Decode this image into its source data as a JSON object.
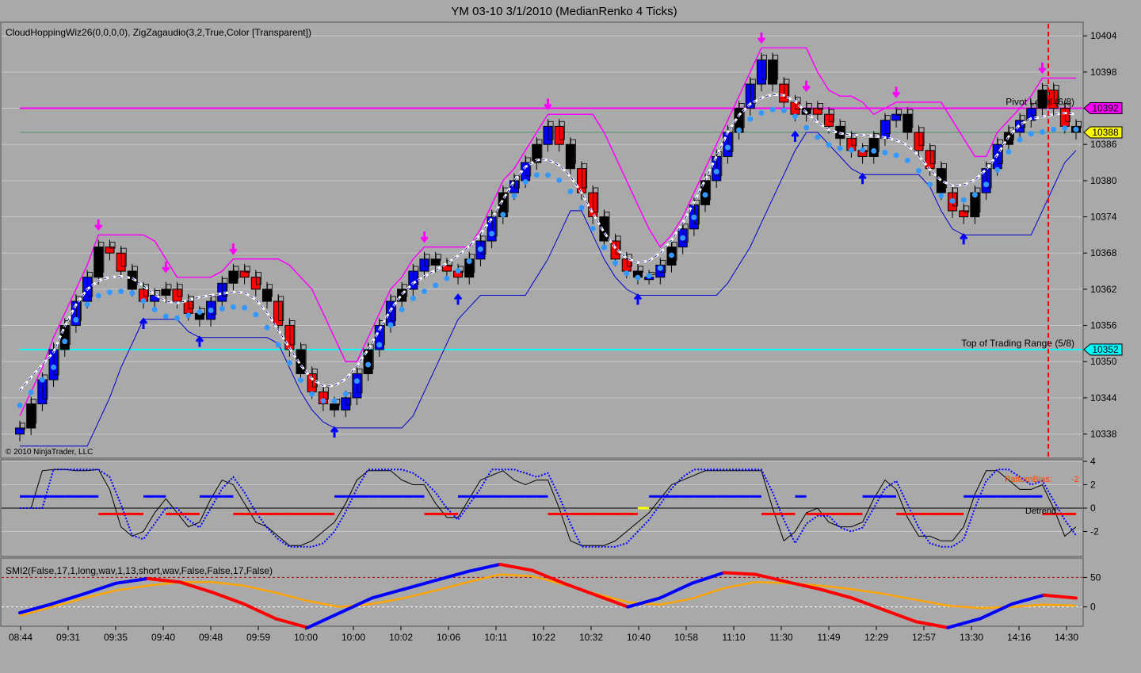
{
  "window": {
    "title": "YM 03-10  3/1/2010 (MedianRenko 4 Ticks)",
    "copyright": "© 2010 NinjaTrader, LLC"
  },
  "colors": {
    "background": "#a9a9a9",
    "up_bar": "#0000ff",
    "down_bar": "#ff0000",
    "neutral_bar": "#000000",
    "magenta": "#ff00ff",
    "cyan": "#00ffff",
    "yellow": "#ffff00",
    "orange": "#ffa500",
    "stop_dot": "#3399ff",
    "pivot_dot": "#ffcc00"
  },
  "chart_data": [
    {
      "type": "candlestick",
      "panel": "price",
      "indicator_label": "CloudHoppingWiz26(0,0,0,0),  ZigZagaudio(3,2,True,Color  [Transparent])",
      "ylim": [
        10334,
        10406
      ],
      "y_ticks": [
        10404,
        10398,
        10392,
        10386,
        10380,
        10374,
        10368,
        10362,
        10356,
        10350,
        10344,
        10338
      ],
      "x_tick_labels": [
        "08:44",
        "09:31",
        "09:35",
        "09:40",
        "09:48",
        "09:59",
        "10:00",
        "10:00",
        "10:02",
        "10:06",
        "10:11",
        "10:22",
        "10:32",
        "10:40",
        "10:58",
        "11:10",
        "11:30",
        "11:49",
        "12:29",
        "12:57",
        "13:30",
        "14:16",
        "14:30"
      ],
      "price_path": [
        10339,
        10343,
        10347,
        10352,
        10356,
        10360,
        10364,
        10369,
        10368,
        10365,
        10362,
        10360,
        10361,
        10362,
        10360,
        10358,
        10357,
        10360,
        10363,
        10365,
        10364,
        10362,
        10360,
        10356,
        10352,
        10348,
        10345,
        10343,
        10342,
        10344,
        10348,
        10352,
        10356,
        10360,
        10362,
        10365,
        10367,
        10366,
        10365,
        10364,
        10367,
        10370,
        10374,
        10378,
        10380,
        10383,
        10386,
        10389,
        10386,
        10382,
        10378,
        10374,
        10370,
        10367,
        10365,
        10364,
        10364,
        10366,
        10369,
        10372,
        10376,
        10380,
        10384,
        10388,
        10392,
        10396,
        10400,
        10396,
        10393,
        10391,
        10392,
        10391,
        10389,
        10387,
        10385,
        10384,
        10387,
        10390,
        10391,
        10388,
        10385,
        10382,
        10378,
        10375,
        10374,
        10378,
        10382,
        10386,
        10388,
        10390,
        10392,
        10395,
        10392,
        10389,
        10388
      ],
      "horizontal_levels": [
        {
          "name": "Pivot Level (6/8)",
          "value": 10392,
          "color": "#ff00ff",
          "tag": "10392"
        },
        {
          "name": "current",
          "value": 10388,
          "color": "#ffff00",
          "tag": "10388"
        },
        {
          "name": "Top of Trading Range (5/8)",
          "value": 10352,
          "color": "#00ffff",
          "tag": "10352"
        }
      ]
    },
    {
      "type": "line",
      "panel": "oscillator",
      "ylim": [
        -4,
        4
      ],
      "y_ticks": [
        "4",
        "2",
        "0",
        "-2"
      ],
      "labels": {
        "bias": "PatternBias:",
        "bias_value": "-2",
        "detrend": "Detrend:"
      }
    },
    {
      "type": "line",
      "panel": "smi",
      "indicator_label": "SMI2(False,17,1,long,wav,1,13,short,wav,False,False,17,False)",
      "ylim": [
        -30,
        80
      ],
      "y_ticks": [
        "50",
        "0"
      ],
      "series": [
        {
          "values": [
            -10,
            5,
            22,
            40,
            48,
            42,
            25,
            5,
            -20,
            -35,
            -10,
            15,
            30,
            45,
            60,
            72,
            62,
            40,
            20,
            0,
            15,
            40,
            58,
            55,
            42,
            30,
            15,
            -5,
            -25,
            -35,
            -20,
            5,
            20,
            15
          ]
        },
        {
          "values": [
            -15,
            0,
            15,
            28,
            36,
            42,
            42,
            36,
            24,
            10,
            0,
            5,
            15,
            28,
            42,
            55,
            52,
            38,
            22,
            8,
            4,
            14,
            32,
            42,
            40,
            36,
            30,
            22,
            12,
            2,
            -2,
            0,
            4,
            2
          ]
        }
      ]
    }
  ]
}
